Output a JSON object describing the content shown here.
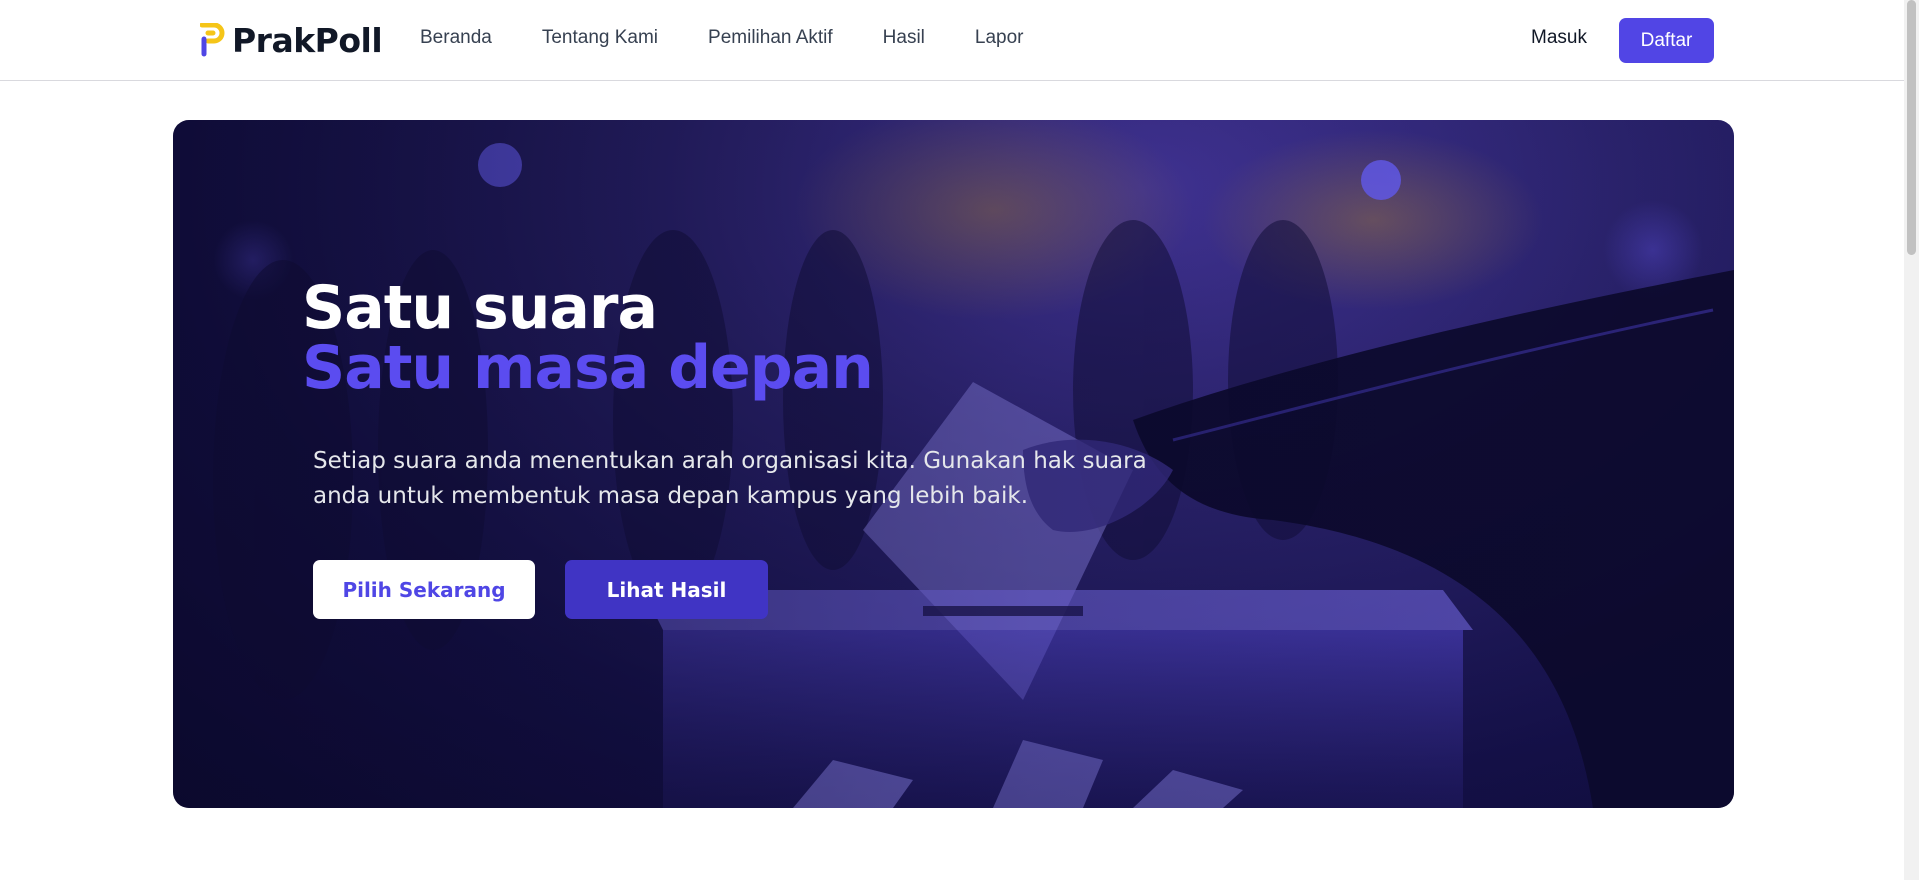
{
  "brand": {
    "name": "PrakPoll",
    "logo_color_top": "#f5c518",
    "logo_color_bottom": "#4f46e5"
  },
  "nav": {
    "links": [
      {
        "label": "Beranda"
      },
      {
        "label": "Tentang Kami"
      },
      {
        "label": "Pemilihan Aktif"
      },
      {
        "label": "Hasil"
      },
      {
        "label": "Lapor"
      }
    ],
    "login_label": "Masuk",
    "register_label": "Daftar"
  },
  "hero": {
    "title_line1": "Satu suara",
    "title_line2": "Satu masa depan",
    "description": "Setiap suara anda menentukan arah organisasi kita. Gunakan hak suara anda untuk membentuk masa depan kampus yang lebih baik.",
    "primary_button": "Pilih Sekarang",
    "secondary_button": "Lihat Hasil",
    "background_image": "ballot-box-voting-photo"
  },
  "colors": {
    "accent": "#5145e5",
    "accent_text": "#5b4cf0"
  }
}
